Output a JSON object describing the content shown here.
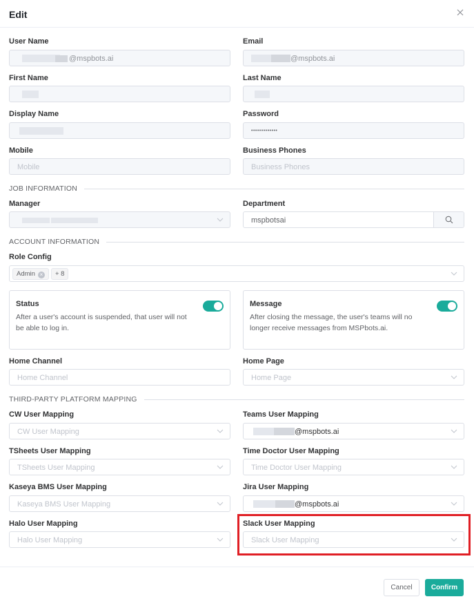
{
  "dialog": {
    "title": "Edit"
  },
  "fields": {
    "user_name": {
      "label": "User Name",
      "value": "@mspbots.ai"
    },
    "email": {
      "label": "Email",
      "value": "@mspbots.ai"
    },
    "first_name": {
      "label": "First Name"
    },
    "last_name": {
      "label": "Last Name"
    },
    "display_name": {
      "label": "Display Name"
    },
    "password": {
      "label": "Password",
      "value": "•••••••••••••"
    },
    "mobile": {
      "label": "Mobile",
      "placeholder": "Mobile"
    },
    "business_phones": {
      "label": "Business Phones",
      "placeholder": "Business Phones"
    }
  },
  "job": {
    "section_title": "JOB INFORMATION",
    "manager_label": "Manager",
    "department_label": "Department",
    "department_value": "mspbotsai"
  },
  "account": {
    "section_title": "ACCOUNT INFORMATION",
    "role_label": "Role Config",
    "role_tag": "Admin",
    "role_more": "+ 8",
    "status": {
      "title": "Status",
      "desc": "After a user's account is suspended, that user will not be able to log in.",
      "enabled": true
    },
    "message": {
      "title": "Message",
      "desc": "After closing the message, the user's teams will no longer receive messages from MSPbots.ai.",
      "enabled": true
    },
    "home_channel": {
      "label": "Home Channel",
      "placeholder": "Home Channel"
    },
    "home_page": {
      "label": "Home Page",
      "placeholder": "Home Page"
    }
  },
  "mapping": {
    "section_title": "THIRD-PARTY PLATFORM MAPPING",
    "cw": {
      "label": "CW User Mapping",
      "placeholder": "CW User Mapping"
    },
    "teams": {
      "label": "Teams User Mapping",
      "value": "@mspbots.ai"
    },
    "tsheets": {
      "label": "TSheets User Mapping",
      "placeholder": "TSheets User Mapping"
    },
    "time_doctor": {
      "label": "Time Doctor User Mapping",
      "placeholder": "Time Doctor User Mapping"
    },
    "kaseya": {
      "label": "Kaseya BMS User Mapping",
      "placeholder": "Kaseya BMS User Mapping"
    },
    "jira": {
      "label": "Jira User Mapping",
      "value": "@mspbots.ai"
    },
    "halo": {
      "label": "Halo User Mapping",
      "placeholder": "Halo User Mapping"
    },
    "slack": {
      "label": "Slack User Mapping",
      "placeholder": "Slack User Mapping"
    }
  },
  "footer": {
    "cancel_label": "Cancel",
    "confirm_label": "Confirm"
  },
  "colors": {
    "accent": "#1aab9b",
    "highlight": "#e01e24"
  }
}
